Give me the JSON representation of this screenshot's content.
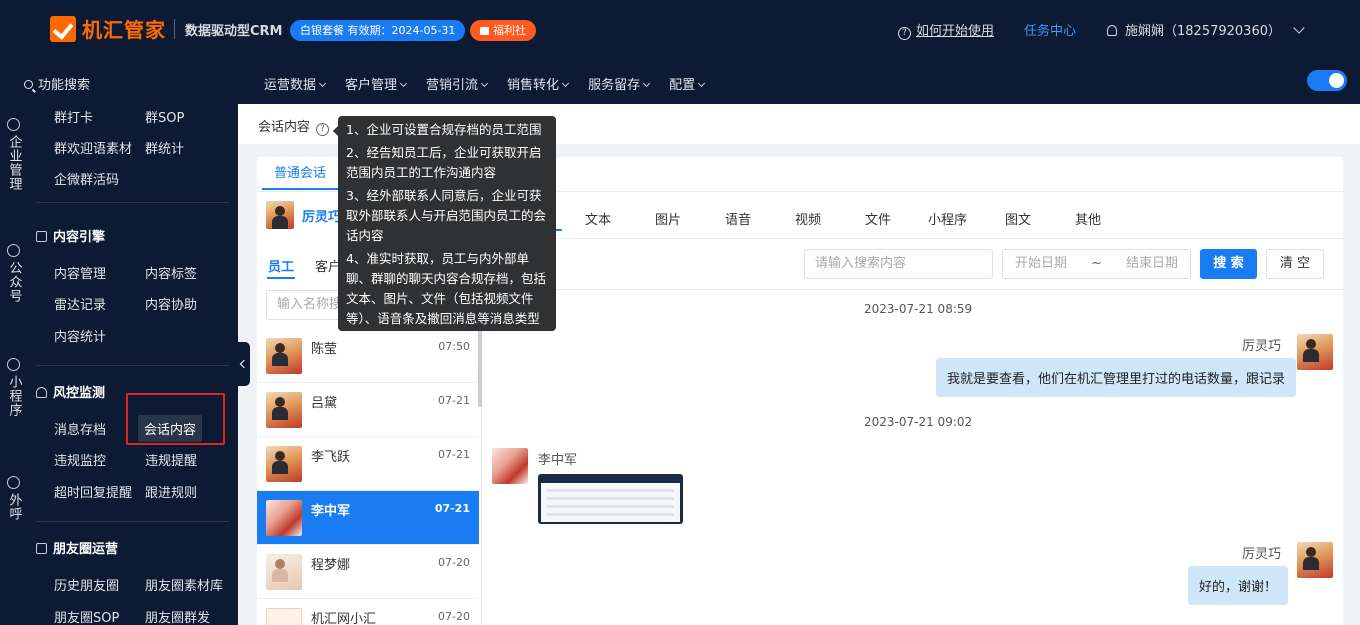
{
  "header": {
    "logo_text": "机汇管家",
    "subtitle": "数据驱动型CRM",
    "package_badge": "白银套餐 有效期：2024-05-31",
    "welfare_badge": "福利社",
    "help_link": "如何开始使用",
    "task_center": "任务中心",
    "user": "施娴娴（18257920360）"
  },
  "navbar": {
    "search_label": "功能搜索",
    "menu": [
      "运营数据",
      "客户管理",
      "营销引流",
      "销售转化",
      "服务留存",
      "配置"
    ],
    "toggle_on": true
  },
  "rail": [
    {
      "label": "企业管理",
      "icon": "building-icon"
    },
    {
      "label": "公众号",
      "icon": "chat-icon"
    },
    {
      "label": "小程序",
      "icon": "compass-icon"
    },
    {
      "label": "外呼",
      "icon": "phone-icon"
    }
  ],
  "sidebar": {
    "top_items": [
      "群打卡",
      "群SOP",
      "群欢迎语素材",
      "群统计",
      "企微群活码"
    ],
    "content_engine": {
      "title": "内容引擎",
      "items": [
        "内容管理",
        "内容标签",
        "雷达记录",
        "内容协助",
        "内容统计"
      ]
    },
    "risk_monitor": {
      "title": "风控监测",
      "items": [
        "消息存档",
        "会话内容",
        "违规监控",
        "违规提醒",
        "超时回复提醒",
        "跟进规则"
      ],
      "active": "会话内容"
    },
    "moments": {
      "title": "朋友圈运营",
      "items": [
        "历史朋友圈",
        "朋友圈素材库",
        "朋友圈SOP",
        "朋友圈群发"
      ]
    }
  },
  "page": {
    "title": "会话内容",
    "tooltip": [
      "1、企业可设置合规存档的员工范围",
      "2、经告知员工后，企业可获取开启范围内员工的工作沟通内容",
      "3、经外部联系人同意后，企业可获取外部联系人与开启范围内员工的会话内容",
      "4、准实时获取，员工与内外部单聊、群聊的聊天内容合规存档，包括文本、图片、文件（包括视频文件等）、语音条及撤回消息等消息类型"
    ]
  },
  "session": {
    "tab": "普通会话",
    "employee_name": "厉灵巧",
    "sub_tabs": [
      "员工",
      "客户"
    ],
    "search_placeholder": "输入名称搜索",
    "contacts": [
      {
        "name": "陈莹",
        "time": "07:50",
        "avatar": "photo"
      },
      {
        "name": "吕黛",
        "time": "07-21",
        "avatar": "photo"
      },
      {
        "name": "李飞跃",
        "time": "07-21",
        "avatar": "photo"
      },
      {
        "name": "李中军",
        "time": "07-21",
        "avatar": "red",
        "selected": true
      },
      {
        "name": "程梦娜",
        "time": "07-20",
        "avatar": "baby"
      },
      {
        "name": "机汇网小汇",
        "time": "07-20",
        "avatar": "brand"
      }
    ],
    "message_types": [
      "文本",
      "图片",
      "语音",
      "视频",
      "文件",
      "小程序",
      "图文",
      "其他"
    ],
    "message_search_placeholder": "请输入搜索内容",
    "date_start": "开始日期",
    "date_sep": "~",
    "date_end": "结束日期",
    "search_btn": "搜 索",
    "clear_btn": "清 空",
    "messages": [
      {
        "timestamp": "2023-07-21 08:59",
        "sender": "厉灵巧",
        "text": "我就是要查看，他们在机汇管理里打过的电话数量，跟记录"
      },
      {
        "timestamp": "2023-07-21 09:02",
        "sender": "李中军",
        "type": "image"
      },
      {
        "sender": "厉灵巧",
        "text": "好的，谢谢！"
      }
    ]
  },
  "colors": {
    "primary": "#1a7cf2",
    "dark_bg": "#0d1a33",
    "brand_orange": "#ff6a00",
    "bubble": "#cfe6fb",
    "highlight_red": "#e02424"
  }
}
